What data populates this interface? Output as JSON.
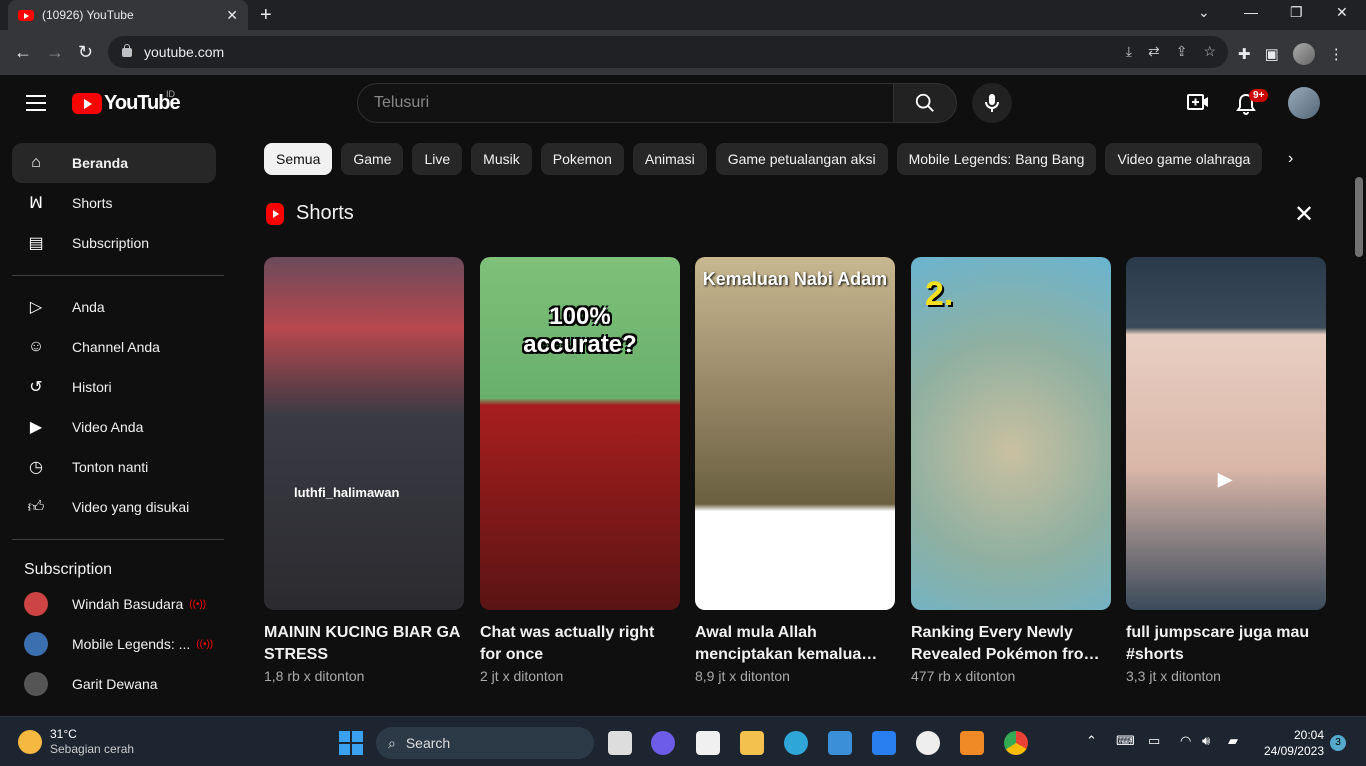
{
  "browser": {
    "tab_title": "(10926) YouTube",
    "url": "youtube.com"
  },
  "header": {
    "logo_text": "YouTube",
    "country_code": "ID",
    "search_placeholder": "Telusuri",
    "notification_badge": "9+"
  },
  "sidebar": {
    "main": [
      {
        "label": "Beranda",
        "icon": "home-icon"
      },
      {
        "label": "Shorts",
        "icon": "shorts-icon"
      },
      {
        "label": "Subscription",
        "icon": "subscriptions-icon"
      }
    ],
    "you": [
      {
        "label": "Anda",
        "icon": "your-channel-icon"
      },
      {
        "label": "Channel Anda",
        "icon": "account-icon"
      },
      {
        "label": "Histori",
        "icon": "history-icon"
      },
      {
        "label": "Video Anda",
        "icon": "your-videos-icon"
      },
      {
        "label": "Tonton nanti",
        "icon": "clock-icon"
      },
      {
        "label": "Video yang disukai",
        "icon": "thumbs-up-icon"
      }
    ],
    "subscriptions_heading": "Subscription",
    "subscriptions": [
      {
        "label": "Windah Basudara",
        "live": true
      },
      {
        "label": "Mobile Legends: ...",
        "live": true
      },
      {
        "label": "Garit Dewana",
        "live": false
      }
    ]
  },
  "chips": [
    "Semua",
    "Game",
    "Live",
    "Musik",
    "Pokemon",
    "Animasi",
    "Game petualangan aksi",
    "Mobile Legends: Bang Bang",
    "Video game olahraga"
  ],
  "shorts": {
    "heading": "Shorts",
    "items": [
      {
        "title": "MAININ KUCING BIAR GA STRESS",
        "views": "1,8 rb x ditonton",
        "overlay": "luthfi_halimawan"
      },
      {
        "title": "Chat was actually right for once",
        "views": "2 jt x ditonton",
        "overlay": "100% accurate?"
      },
      {
        "title": "Awal mula Allah menciptakan kemalua…",
        "views": "8,9 jt x ditonton",
        "overlay": "Kemaluan Nabi Adam"
      },
      {
        "title": "Ranking Every Newly Revealed Pokémon fro…",
        "views": "477 rb x ditonton",
        "overlay": "2."
      },
      {
        "title": "full jumpscare juga mau #shorts",
        "views": "3,3 jt x ditonton",
        "overlay": ""
      }
    ]
  },
  "taskbar": {
    "temperature": "31°C",
    "weather": "Sebagian cerah",
    "search_label": "Search",
    "time": "20:04",
    "date": "24/09/2023",
    "notification_count": "3"
  }
}
